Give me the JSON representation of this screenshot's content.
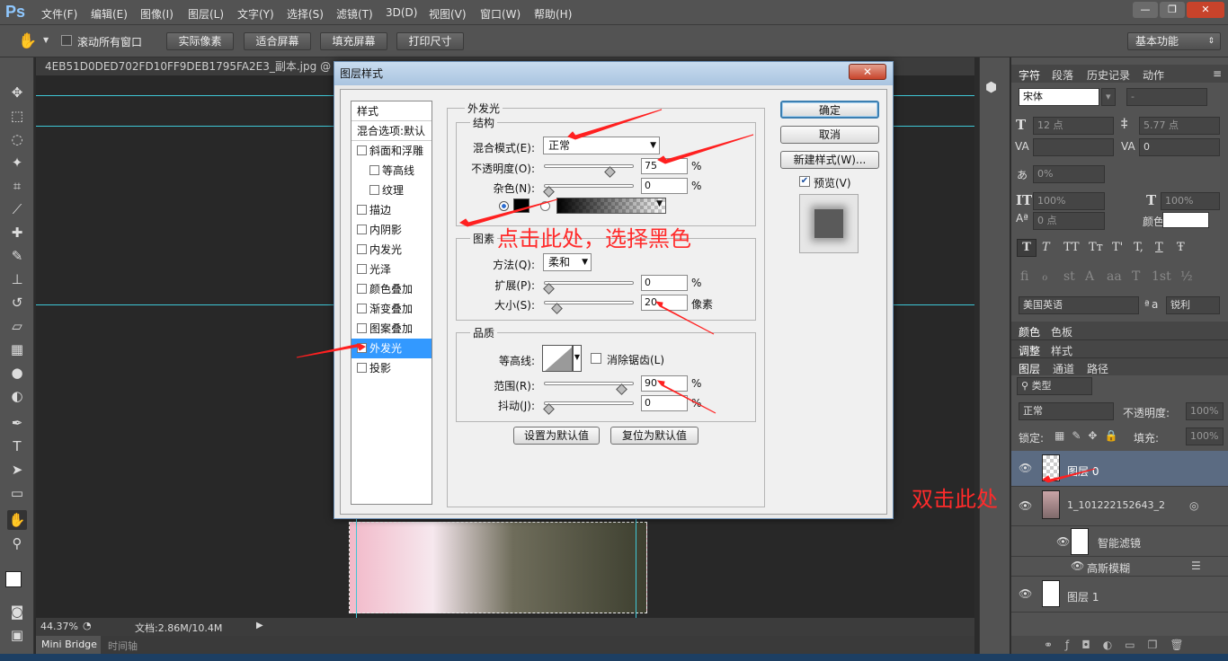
{
  "app": {
    "logo": "Ps",
    "menu": [
      "文件(F)",
      "编辑(E)",
      "图像(I)",
      "图层(L)",
      "文字(Y)",
      "选择(S)",
      "滤镜(T)",
      "3D(D)",
      "视图(V)",
      "窗口(W)",
      "帮助(H)"
    ],
    "window_buttons": {
      "minimize": "—",
      "restore": "❐",
      "close": "✕"
    }
  },
  "options_bar": {
    "scroll_all": "滚动所有窗口",
    "actual_pixels": "实际像素",
    "fit_screen": "适合屏幕",
    "fill_screen": "填充屏幕",
    "print_size": "打印尺寸",
    "workspace": "基本功能"
  },
  "document": {
    "tab_title": "4EB51D0DED702FD10FF9DEB1795FA2E3_副本.jpg @ 44.4",
    "zoom": "44.37%",
    "doc_info": "文档:2.86M/10.4M"
  },
  "bottom_tabs": [
    "Mini Bridge",
    "时间轴"
  ],
  "dialog": {
    "title": "图层样式",
    "close": "✕",
    "styles_header": "样式",
    "blend_options": "混合选项:默认",
    "styles": [
      {
        "label": "斜面和浮雕",
        "sub": false,
        "selected": false
      },
      {
        "label": "等高线",
        "sub": true,
        "selected": false
      },
      {
        "label": "纹理",
        "sub": true,
        "selected": false
      },
      {
        "label": "描边",
        "sub": false,
        "selected": false
      },
      {
        "label": "内阴影",
        "sub": false,
        "selected": false
      },
      {
        "label": "内发光",
        "sub": false,
        "selected": false
      },
      {
        "label": "光泽",
        "sub": false,
        "selected": false
      },
      {
        "label": "颜色叠加",
        "sub": false,
        "selected": false
      },
      {
        "label": "渐变叠加",
        "sub": false,
        "selected": false
      },
      {
        "label": "图案叠加",
        "sub": false,
        "selected": false
      },
      {
        "label": "外发光",
        "sub": false,
        "selected": true
      },
      {
        "label": "投影",
        "sub": false,
        "selected": false
      }
    ],
    "section_title": "外发光",
    "structure": {
      "title": "结构",
      "blend_mode_label": "混合模式(E):",
      "blend_mode": "正常",
      "opacity_label": "不透明度(O):",
      "opacity": "75",
      "opacity_unit": "%",
      "noise_label": "杂色(N):",
      "noise": "0",
      "noise_unit": "%"
    },
    "elements": {
      "title": "图素",
      "technique_label": "方法(Q):",
      "technique": "柔和",
      "spread_label": "扩展(P):",
      "spread": "0",
      "spread_unit": "%",
      "size_label": "大小(S):",
      "size": "20",
      "size_unit": "像素"
    },
    "quality": {
      "title": "品质",
      "contour_label": "等高线:",
      "antialias_label": "消除锯齿(L)",
      "range_label": "范围(R):",
      "range": "90",
      "range_unit": "%",
      "jitter_label": "抖动(J):",
      "jitter": "0",
      "jitter_unit": "%"
    },
    "set_default": "设置为默认值",
    "reset_default": "复位为默认值",
    "ok": "确定",
    "cancel": "取消",
    "new_style": "新建样式(W)...",
    "preview_label": "预览(V)",
    "slider_levels": {
      "opacity": 0.75,
      "noise": 0.0,
      "spread": 0.0,
      "size": 0.1,
      "range": 0.9,
      "jitter": 0.0
    }
  },
  "annotations": {
    "click_here": "点击此处，选择黑色",
    "double_click": "双击此处"
  },
  "char_panel": {
    "tabs": [
      "字符",
      "段落",
      "历史记录",
      "动作"
    ],
    "font": "宋体",
    "style": "-",
    "size": "12 点",
    "leading": "5.77 点",
    "tracking": "0",
    "scale_pct": "0%",
    "v_scale": "100%",
    "h_scale": "100%",
    "baseline": "0 点",
    "color_label": "颜色:",
    "language": "美国英语",
    "aa_label": "a",
    "aa_value": "锐利",
    "type_buttons": [
      "T",
      "T",
      "TT",
      "Tт",
      "T'",
      "T,",
      "T",
      "Ŧ"
    ],
    "ot_buttons": [
      "fi",
      "ℴ",
      "st",
      "A",
      "aa",
      "T",
      "1st",
      "½"
    ]
  },
  "panels_mid": {
    "color_tabs": [
      "颜色",
      "色板"
    ],
    "adjust_tabs": [
      "调整",
      "样式"
    ]
  },
  "layers_panel": {
    "tabs": [
      "图层",
      "通道",
      "路径"
    ],
    "filter": "类型",
    "blend": "正常",
    "opacity_label": "不透明度:",
    "opacity": "100%",
    "lock_label": "锁定:",
    "fill_label": "填充:",
    "fill": "100%",
    "layers": [
      {
        "name": "图层 0",
        "selected": true
      },
      {
        "name": "1_101222152643_2",
        "selected": false
      },
      {
        "name": "智能滤镜",
        "selected": false
      },
      {
        "name": "高斯模糊",
        "selected": false
      },
      {
        "name": "图层 1",
        "selected": false
      }
    ]
  },
  "colors": {
    "accent": "#3399ff",
    "annotation": "#ff2b2b",
    "guide": "#3fc7d6"
  }
}
